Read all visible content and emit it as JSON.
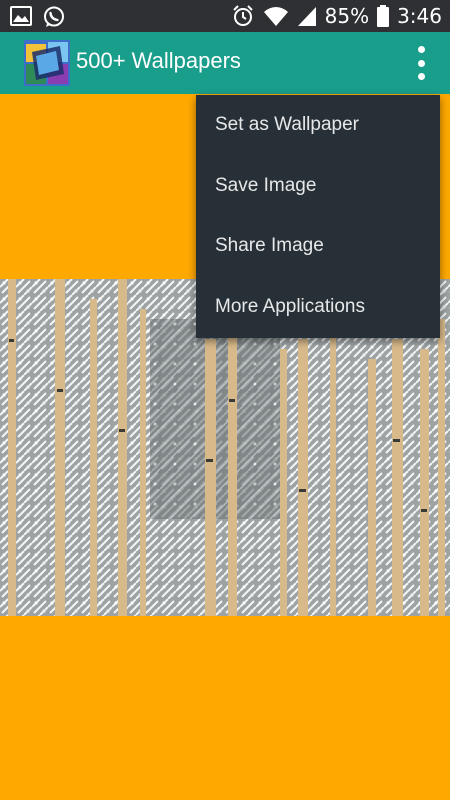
{
  "status_bar": {
    "battery_percent": "85%",
    "time": "3:46",
    "icons": [
      "image-icon",
      "whatsapp-icon",
      "alarm-icon",
      "wifi-icon",
      "signal-icon",
      "battery-icon"
    ]
  },
  "app_bar": {
    "title": "500+ Wallpapers",
    "logo_icon": "app-logo-icon",
    "overflow_icon": "more-vert-icon",
    "color": "#1A9E8C"
  },
  "content": {
    "background_color": "#FFA800",
    "image": "frosted-birch-forest"
  },
  "overflow_menu": {
    "items": [
      {
        "label": "Set as Wallpaper"
      },
      {
        "label": "Save Image"
      },
      {
        "label": "Share Image"
      },
      {
        "label": "More Applications"
      }
    ],
    "background_color": "#273036"
  }
}
